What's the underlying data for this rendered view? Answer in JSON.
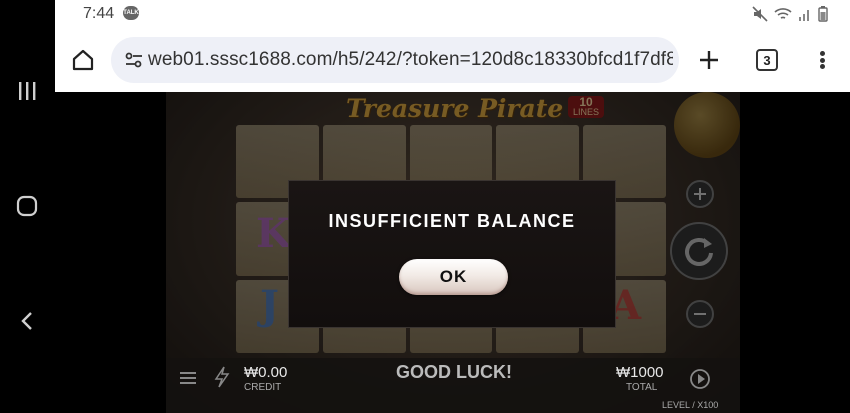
{
  "status_bar": {
    "time": "7:44",
    "notification_badge": "TALK",
    "icons": [
      "mute-icon",
      "wifi-icon",
      "signal-icon",
      "battery-icon"
    ]
  },
  "browser": {
    "url": "web01.sssc1688.com/h5/242/?token=120d8c18330bfcd1f7df8",
    "tab_count": "3",
    "icons": [
      "home-icon",
      "site-info-icon",
      "plus-icon",
      "overflow-menu-icon"
    ]
  },
  "nav": {
    "icons": [
      "recent-apps-icon",
      "home-circle-icon",
      "back-icon"
    ]
  },
  "game": {
    "title": "Treasure Pirate",
    "lines_number": "10",
    "lines_label": "LINES",
    "credit_value": "₩0.00",
    "credit_label": "CREDIT",
    "message": "GOOD LUCK!",
    "total_value": "₩1000",
    "total_label": "TOTAL",
    "level_label": "LEVEL",
    "level_value": "X100"
  },
  "dialog": {
    "title": "INSUFFICIENT BALANCE",
    "ok_label": "OK"
  },
  "colors": {
    "dialog_bg": "#150f0e",
    "ok_button": "#f2ebe6",
    "title_gold": "#d9a640"
  }
}
